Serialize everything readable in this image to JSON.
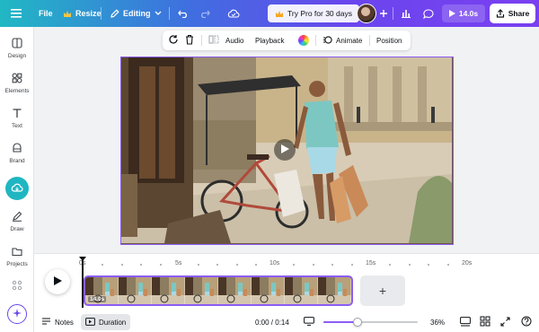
{
  "topbar": {
    "file_label": "File",
    "resize_label": "Resize",
    "editing_label": "Editing",
    "pro_label": "Try Pro for 30 days",
    "time_label": "14.0s",
    "share_label": "Share"
  },
  "sidebar": {
    "items": [
      {
        "label": "Design",
        "icon": "design-icon"
      },
      {
        "label": "Elements",
        "icon": "elements-icon"
      },
      {
        "label": "Text",
        "icon": "text-icon"
      },
      {
        "label": "Brand",
        "icon": "brand-icon"
      },
      {
        "label": "Draw",
        "icon": "draw-icon"
      },
      {
        "label": "Projects",
        "icon": "projects-icon"
      }
    ]
  },
  "context_toolbar": {
    "audio_label": "Audio",
    "playback_label": "Playback",
    "animate_label": "Animate",
    "position_label": "Position"
  },
  "timeline": {
    "ticks": [
      "0s",
      "5s",
      "10s",
      "15s",
      "20s"
    ],
    "clip_duration": "14.0s",
    "add_label": "+"
  },
  "bottombar": {
    "notes_label": "Notes",
    "duration_label": "Duration",
    "time_readout": "0:00 / 0:14",
    "zoom_label": "36%",
    "zoom_level": 0.36
  },
  "colors": {
    "accent": "#8b5cf6",
    "topbar_start": "#21b8c4",
    "topbar_end": "#7a3ff0"
  }
}
